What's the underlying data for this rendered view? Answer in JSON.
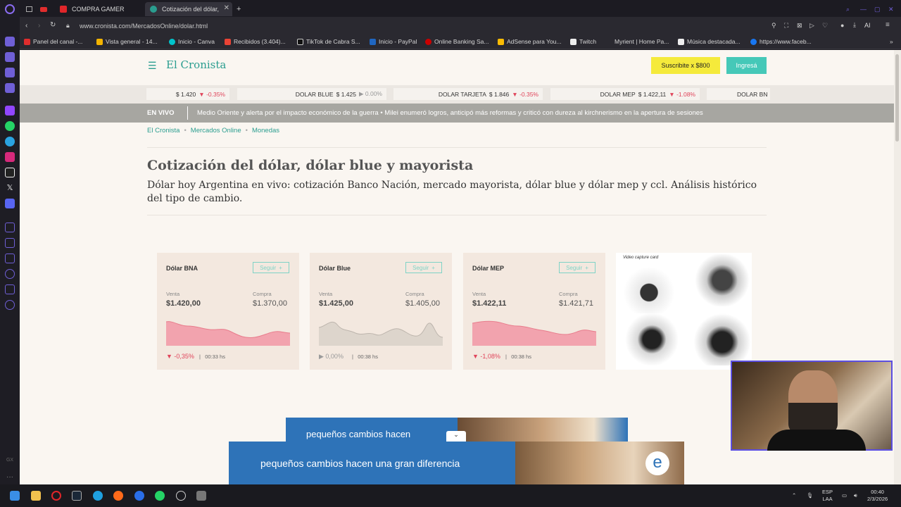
{
  "browser": {
    "tabs": [
      {
        "label": "COMPRA GAMER",
        "active": false
      },
      {
        "label": "Cotización del dólar,",
        "active": true
      }
    ],
    "new_tab": "+",
    "url": "www.cronista.com/MercadosOnline/dolar.html",
    "ai_label": "AI",
    "bookmarks": [
      "Panel del canal -...",
      "Vista general - 14...",
      "Inicio - Canva",
      "Recibidos (3.404)...",
      "TikTok de Cabra S...",
      "Inicio - PayPal",
      "Online Banking Sa...",
      "AdSense para You...",
      "Twitch",
      "Myrient | Home Pa...",
      "Música destacada...",
      "https://www.faceb..."
    ]
  },
  "site": {
    "logo": "El Cronista",
    "subscribe": "Suscribite x $800",
    "login": "Ingresá",
    "ticker": [
      {
        "name": "",
        "price": "$ 1.420",
        "change": "-0.35%",
        "dir": "down"
      },
      {
        "name": "DOLAR BLUE",
        "price": "$ 1.425",
        "change": "0.00%",
        "dir": "flat"
      },
      {
        "name": "DOLAR TARJETA",
        "price": "$ 1.846",
        "change": "-0.35%",
        "dir": "down"
      },
      {
        "name": "DOLAR MEP",
        "price": "$ 1.422,11",
        "change": "-1.08%",
        "dir": "down"
      },
      {
        "name": "DOLAR BN",
        "price": "",
        "change": "",
        "dir": "flat"
      }
    ],
    "live_label": "EN VIVO",
    "live_news": "Medio Oriente y alerta por el impacto económico de la guerra   •   Milei enumeró logros, anticipó más reformas y criticó con dureza al kirchnerismo en la apertura de sesiones",
    "breadcrumb": [
      "El Cronista",
      "Mercados Online",
      "Monedas"
    ],
    "title": "Cotización del dólar, dólar blue y mayorista",
    "subtitle": "Dólar hoy Argentina en vivo: cotización Banco Nación, mercado mayorista, dólar blue y dólar mep y ccl. Análisis histórico del tipo de cambio.",
    "cards": [
      {
        "name": "Dólar BNA",
        "follow": "Seguir",
        "venta_label": "Venta",
        "venta": "$1.420,00",
        "compra_label": "Compra",
        "compra": "$1.370,00",
        "change": "-0,35%",
        "dir": "down",
        "time": "00:33 hs",
        "color": "#e0455b"
      },
      {
        "name": "Dólar Blue",
        "follow": "Seguir",
        "venta_label": "Venta",
        "venta": "$1.425,00",
        "compra_label": "Compra",
        "compra": "$1.405,00",
        "change": "0,00%",
        "dir": "flat",
        "time": "00:38 hs",
        "color": "#9a9a9a"
      },
      {
        "name": "Dólar MEP",
        "follow": "Seguir",
        "venta_label": "Venta",
        "venta": "$1.422,11",
        "compra_label": "Compra",
        "compra": "$1.421,71",
        "change": "-1,08%",
        "dir": "down",
        "time": "00:38 hs",
        "color": "#e0455b"
      }
    ],
    "ad_caption": "Video capture card",
    "banner_text": "pequeños cambios hacen",
    "bottom_ad_text_1": "pequeños cambios hacen ",
    "bottom_ad_text_2": "una gran diferencia",
    "collapse_glyph": "⌄"
  },
  "taskbar": {
    "lang_1": "ESP",
    "lang_2": "LAA",
    "time": "00:40",
    "date": "2/3/2026"
  }
}
